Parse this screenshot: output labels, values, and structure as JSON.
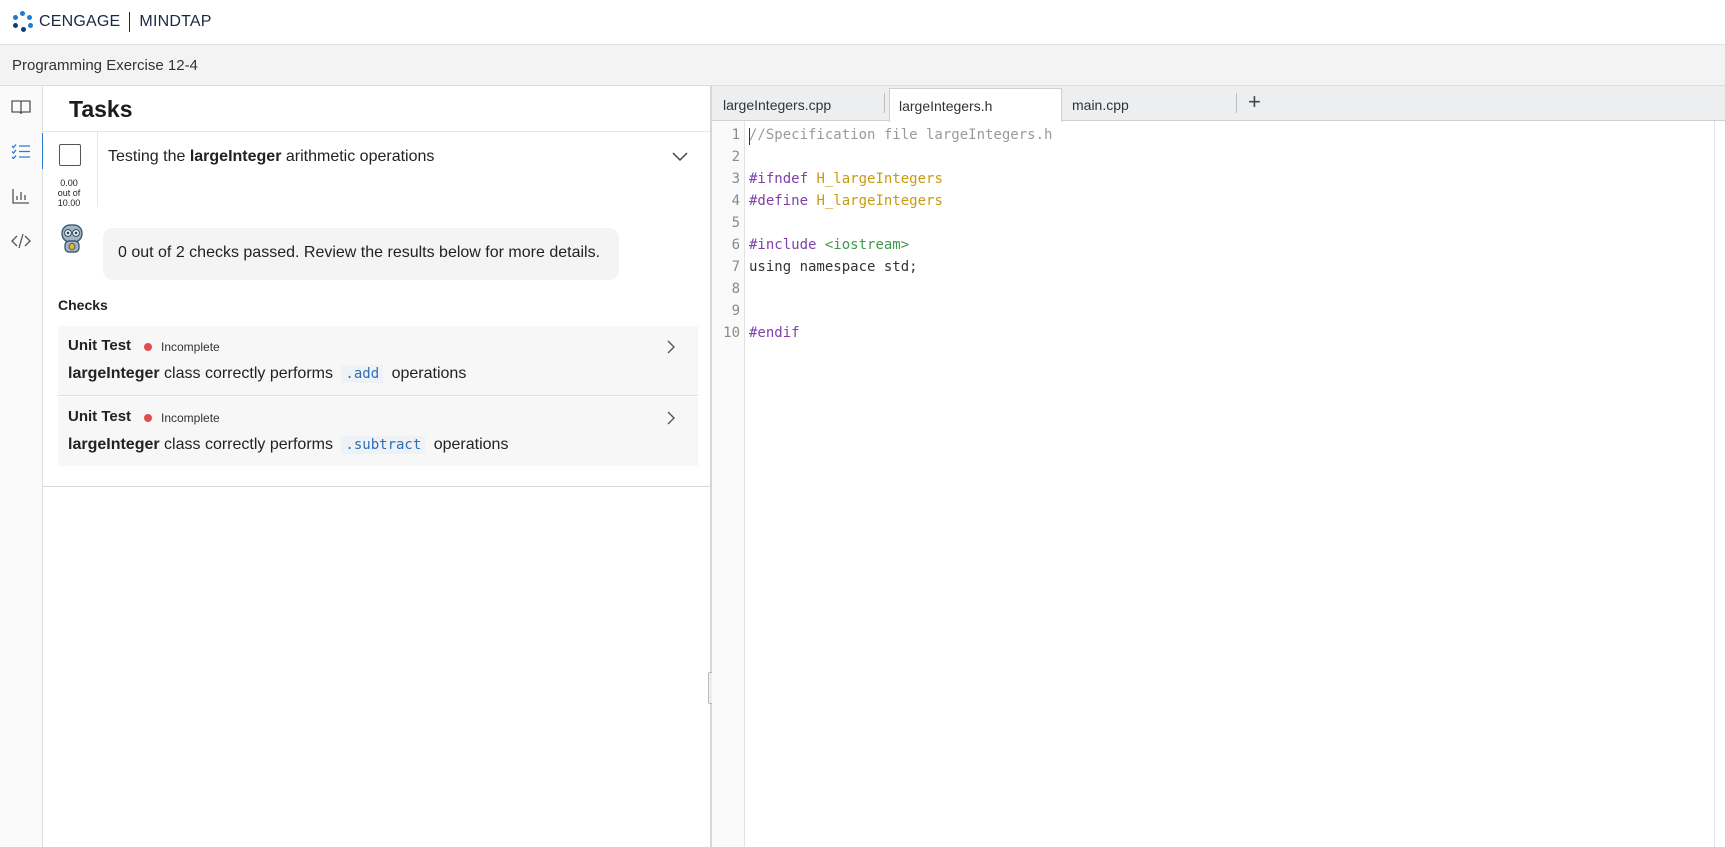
{
  "brand": {
    "company": "CENGAGE",
    "product": "MINDTAP"
  },
  "title": "Programming Exercise 12-4",
  "nav": {
    "items": [
      {
        "icon": "book-icon"
      },
      {
        "icon": "task-list-icon",
        "active": true
      },
      {
        "icon": "bar-chart-icon"
      },
      {
        "icon": "code-icon"
      }
    ]
  },
  "tasks": {
    "heading": "Tasks",
    "task": {
      "title_prefix": "Testing the ",
      "title_bold": "largeInteger",
      "title_suffix": " arithmetic operations",
      "score": {
        "value": "0.00",
        "out_of": "out of",
        "max": "10.00"
      },
      "feedback": "0 out of 2 checks passed. Review the results below for more details.",
      "checks_label": "Checks",
      "checks": [
        {
          "type": "Unit Test",
          "status": "Incomplete",
          "class": "largeInteger",
          "desc_mid": "class correctly performs",
          "method": ".add",
          "desc_end": "operations"
        },
        {
          "type": "Unit Test",
          "status": "Incomplete",
          "class": "largeInteger",
          "desc_mid": "class correctly performs",
          "method": ".subtract",
          "desc_end": "operations"
        }
      ]
    }
  },
  "editor": {
    "tabs": [
      "largeIntegers.cpp",
      "largeIntegers.h",
      "main.cpp"
    ],
    "active_tab": "largeIntegers.h",
    "add_tab_label": "+",
    "line_numbers": [
      "1",
      "2",
      "3",
      "4",
      "5",
      "6",
      "7",
      "8",
      "9",
      "10"
    ],
    "code": {
      "l1": "//Specification file largeIntegers.h",
      "l3_kw": "#ifndef",
      "l3_macro": "H_largeIntegers",
      "l4_kw": "#define",
      "l4_macro": "H_largeIntegers",
      "l6_kw": "#include",
      "l6_str": "<iostream>",
      "l7": "using namespace std;",
      "l10_kw": "#endif"
    }
  }
}
